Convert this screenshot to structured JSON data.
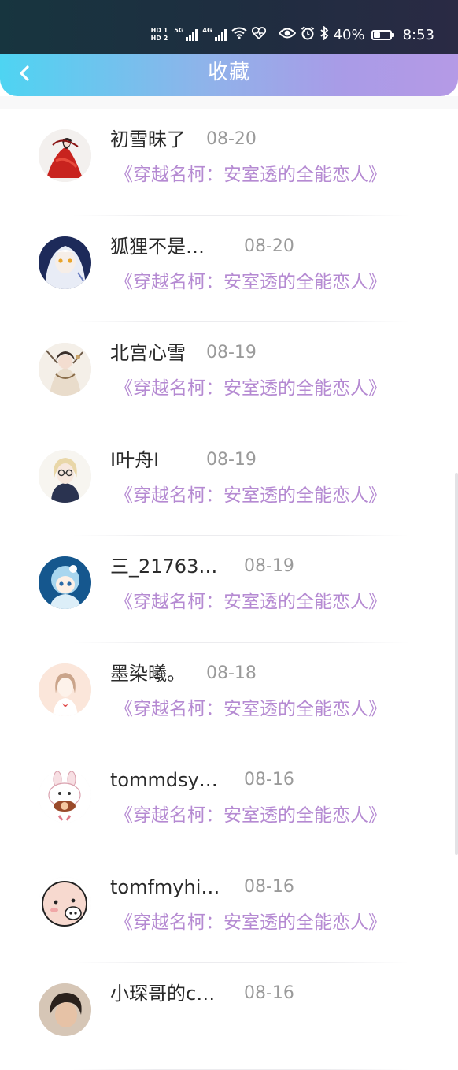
{
  "status": {
    "hd1": "HD 1",
    "hd2": "HD 2",
    "net1": "5G",
    "net2": "4G",
    "battery_text": "40%",
    "battery_level": 0.4,
    "time": "8:53"
  },
  "header": {
    "back_icon": "chevron-left-icon",
    "title": "收藏"
  },
  "favorites": [
    {
      "name": "初雪昧了",
      "date": "08-20",
      "book": "《穿越名柯：安室透的全能恋人》",
      "avatar": "red-robe-girl"
    },
    {
      "name": "狐狸不是…",
      "date": "08-20",
      "book": "《穿越名柯：安室透的全能恋人》",
      "avatar": "white-hair-anime"
    },
    {
      "name": "北宫心雪",
      "date": "08-19",
      "book": "《穿越名柯：安室透的全能恋人》",
      "avatar": "ancient-lady"
    },
    {
      "name": "I叶舟I",
      "date": "08-19",
      "book": "《穿越名柯：安室透的全能恋人》",
      "avatar": "glasses-girl"
    },
    {
      "name": "三_21763…",
      "date": "08-19",
      "book": "《穿越名柯：安室透的全能恋人》",
      "avatar": "blue-chibi"
    },
    {
      "name": "墨染曦。",
      "date": "08-18",
      "book": "《穿越名柯：安室透的全能恋人》",
      "avatar": "sketch-girl"
    },
    {
      "name": "tommdsy…",
      "date": "08-16",
      "book": "《穿越名柯：安室透的全能恋人》",
      "avatar": "rabbit-cartoon"
    },
    {
      "name": "tomfmyhi…",
      "date": "08-16",
      "book": "《穿越名柯：安室透的全能恋人》",
      "avatar": "pig-cartoon"
    },
    {
      "name": "小琛哥的c…",
      "date": "08-16",
      "book": "",
      "avatar": "boy-photo"
    }
  ]
}
